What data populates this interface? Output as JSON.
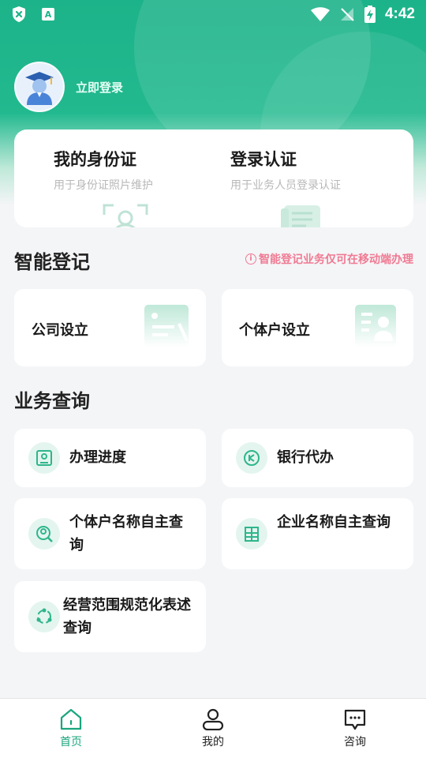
{
  "status_bar": {
    "time": "4:42"
  },
  "profile": {
    "login_label": "立即登录"
  },
  "id_card": {
    "items": [
      {
        "title": "我的身份证",
        "subtitle": "用于身份证照片维护",
        "icon": "face-scan-icon"
      },
      {
        "title": "登录认证",
        "subtitle": "用于业务人员登录认证",
        "icon": "document-icon"
      }
    ]
  },
  "smart_registration": {
    "title": "智能登记",
    "notice": "智能登记业务仅可在移动端办理",
    "cards": [
      {
        "label": "公司设立",
        "icon": "company-card-icon"
      },
      {
        "label": "个体户设立",
        "icon": "id-card-person-icon"
      }
    ]
  },
  "business_query": {
    "title": "业务查询",
    "items": [
      {
        "label": "办理进度",
        "icon": "progress-icon"
      },
      {
        "label": "银行代办",
        "icon": "bank-icon"
      },
      {
        "label": "个体户名称自主查询",
        "icon": "search-person-icon"
      },
      {
        "label": "企业名称自主查询",
        "icon": "building-icon"
      },
      {
        "label": "经营范围规范化表述查询",
        "icon": "cycle-icon"
      }
    ]
  },
  "tabbar": {
    "tabs": [
      {
        "label": "首页",
        "icon": "home-icon",
        "active": true
      },
      {
        "label": "我的",
        "icon": "user-icon",
        "active": false
      },
      {
        "label": "咨询",
        "icon": "chat-icon",
        "active": false
      }
    ]
  },
  "colors": {
    "primary": "#1db38a",
    "accent_text": "#1aa57e",
    "notice": "#f07a93"
  }
}
